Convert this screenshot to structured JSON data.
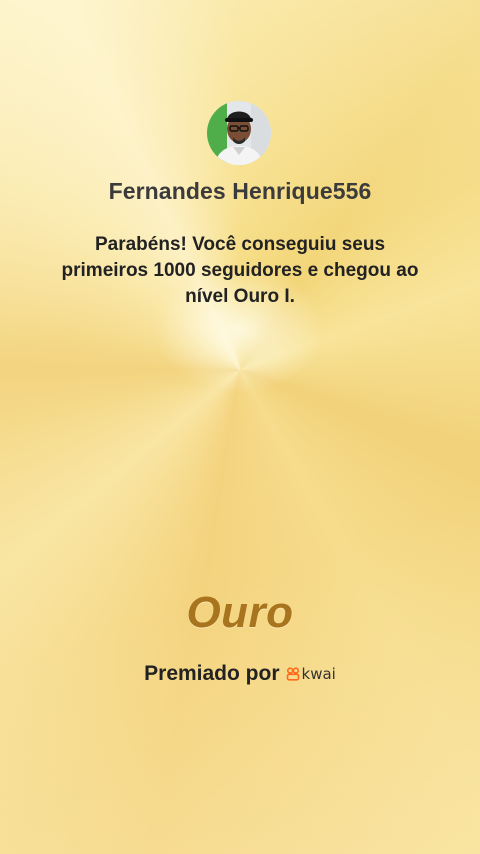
{
  "user": {
    "name": "Fernandes Henrique556"
  },
  "message": "Parabéns! Você conseguiu seus primeiros 1000 seguidores e chegou ao nível Ouro I.",
  "tier": {
    "label": "Ouro",
    "accent_color": "#a8741e"
  },
  "awarded_by": {
    "label": "Premiado por",
    "brand": "kwai",
    "brand_color": "#ff6a1a",
    "icon": "kwai-logo-icon"
  },
  "background": {
    "colors": [
      "#f6dd86",
      "#f9e6a4",
      "#fdf0c2"
    ]
  }
}
